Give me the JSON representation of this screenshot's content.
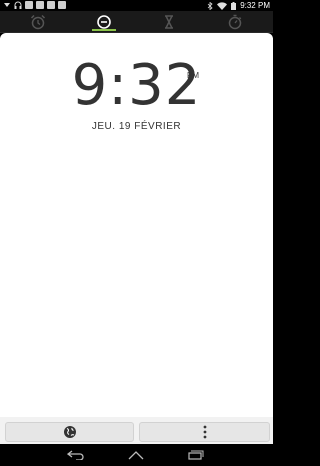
{
  "status_bar": {
    "time": "9:32",
    "time_suffix": "PM"
  },
  "tabs": [
    {
      "icon": "alarm-icon",
      "selected": false
    },
    {
      "icon": "clock-icon",
      "selected": true
    },
    {
      "icon": "hourglass-icon",
      "selected": false
    },
    {
      "icon": "stopwatch-icon",
      "selected": false
    }
  ],
  "clock": {
    "time": "9:32",
    "ampm": "PM",
    "date": "JEU. 19 FÉVRIER"
  },
  "bottom_bar": {
    "left_icon": "world-icon",
    "right_icon": "more-vert-icon"
  },
  "nav_bar": {
    "back_icon": "back-icon",
    "home_icon": "home-icon",
    "recents_icon": "recents-icon"
  },
  "colors": {
    "accent": "#8bc34a",
    "text": "#333333",
    "content_bg": "#ffffff",
    "tab_bg": "#1a1a1a"
  }
}
